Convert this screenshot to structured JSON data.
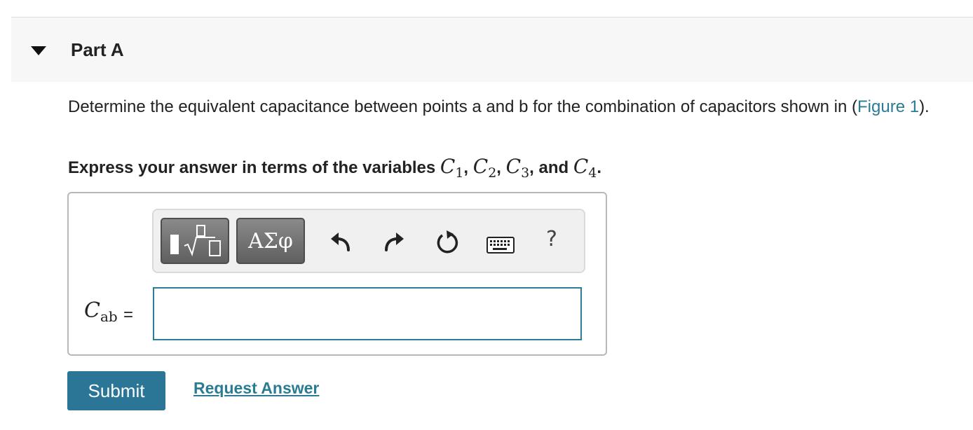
{
  "part": {
    "title": "Part A"
  },
  "question": {
    "text_before": "Determine the equivalent capacitance between points a and b for the combination of capacitors shown in (",
    "figure_link": "Figure 1",
    "text_after": ")."
  },
  "instruction": {
    "prefix": "Express your answer in terms of the variables ",
    "var1": "C",
    "sub1": "1",
    "sep1": ", ",
    "var2": "C",
    "sub2": "2",
    "sep2": ", ",
    "var3": "C",
    "sub3": "3",
    "sep3": ", and ",
    "var4": "C",
    "sub4": "4",
    "suffix": "."
  },
  "toolbar": {
    "templates_icon": "templates-sqrt-icon",
    "symbols_label": "ΑΣφ",
    "undo_icon": "undo-icon",
    "redo_icon": "redo-icon",
    "reset_icon": "reset-icon",
    "keyboard_icon": "keyboard-icon",
    "help_label": "?"
  },
  "answer": {
    "var": "C",
    "sub": "ab",
    "equals": "=",
    "value": ""
  },
  "actions": {
    "submit_label": "Submit",
    "request_label": "Request Answer"
  },
  "colors": {
    "accent": "#2b7697",
    "link": "#2a7c93",
    "header_bg": "#f7f7f7"
  }
}
